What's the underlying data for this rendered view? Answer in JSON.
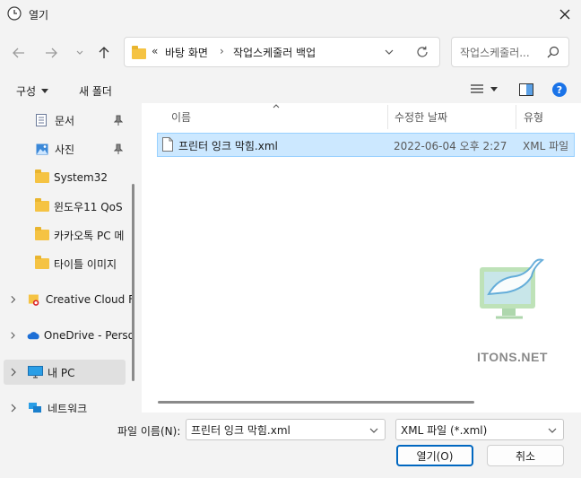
{
  "window": {
    "title": "열기"
  },
  "address": {
    "overflow": "«",
    "crumbs": [
      "바탕 화면",
      "작업스케줄러 백업"
    ],
    "separator": "›"
  },
  "search": {
    "placeholder": "작업스케줄러..."
  },
  "toolbar": {
    "organize": "구성",
    "new_folder": "새 폴더"
  },
  "nav": {
    "items": [
      {
        "label": "문서",
        "icon": "document-icon",
        "pinned": true
      },
      {
        "label": "사진",
        "icon": "picture-icon",
        "pinned": true
      },
      {
        "label": "System32",
        "icon": "folder-icon"
      },
      {
        "label": "윈도우11 QoS",
        "icon": "folder-icon"
      },
      {
        "label": "카카오톡 PC 메",
        "icon": "folder-icon"
      },
      {
        "label": "타이틀 이미지",
        "icon": "folder-icon"
      },
      {
        "label": "Creative Cloud F",
        "icon": "creative-cloud-icon",
        "expandable": true
      },
      {
        "label": "OneDrive - Perso",
        "icon": "onedrive-icon",
        "expandable": true
      },
      {
        "label": "내 PC",
        "icon": "pc-icon",
        "expandable": true,
        "selected": true
      },
      {
        "label": "네트워크",
        "icon": "network-icon",
        "expandable": true
      }
    ]
  },
  "columns": {
    "name": "이름",
    "modified": "수정한 날짜",
    "type": "유형"
  },
  "files": [
    {
      "name": "프린터 잉크 막힘.xml",
      "modified": "2022-06-04 오후 2:27",
      "type": "XML 파일"
    }
  ],
  "watermark": {
    "text": "ITONS.NET"
  },
  "footer": {
    "filename_label": "파일 이름(N):",
    "filename_value": "프린터 잉크 막힘.xml",
    "filter_value": "XML 파일 (*.xml)",
    "open_label": "열기(O)",
    "cancel_label": "취소"
  },
  "colors": {
    "accent": "#0067c0",
    "selection": "#cce8ff",
    "folder": "#f5c343"
  }
}
